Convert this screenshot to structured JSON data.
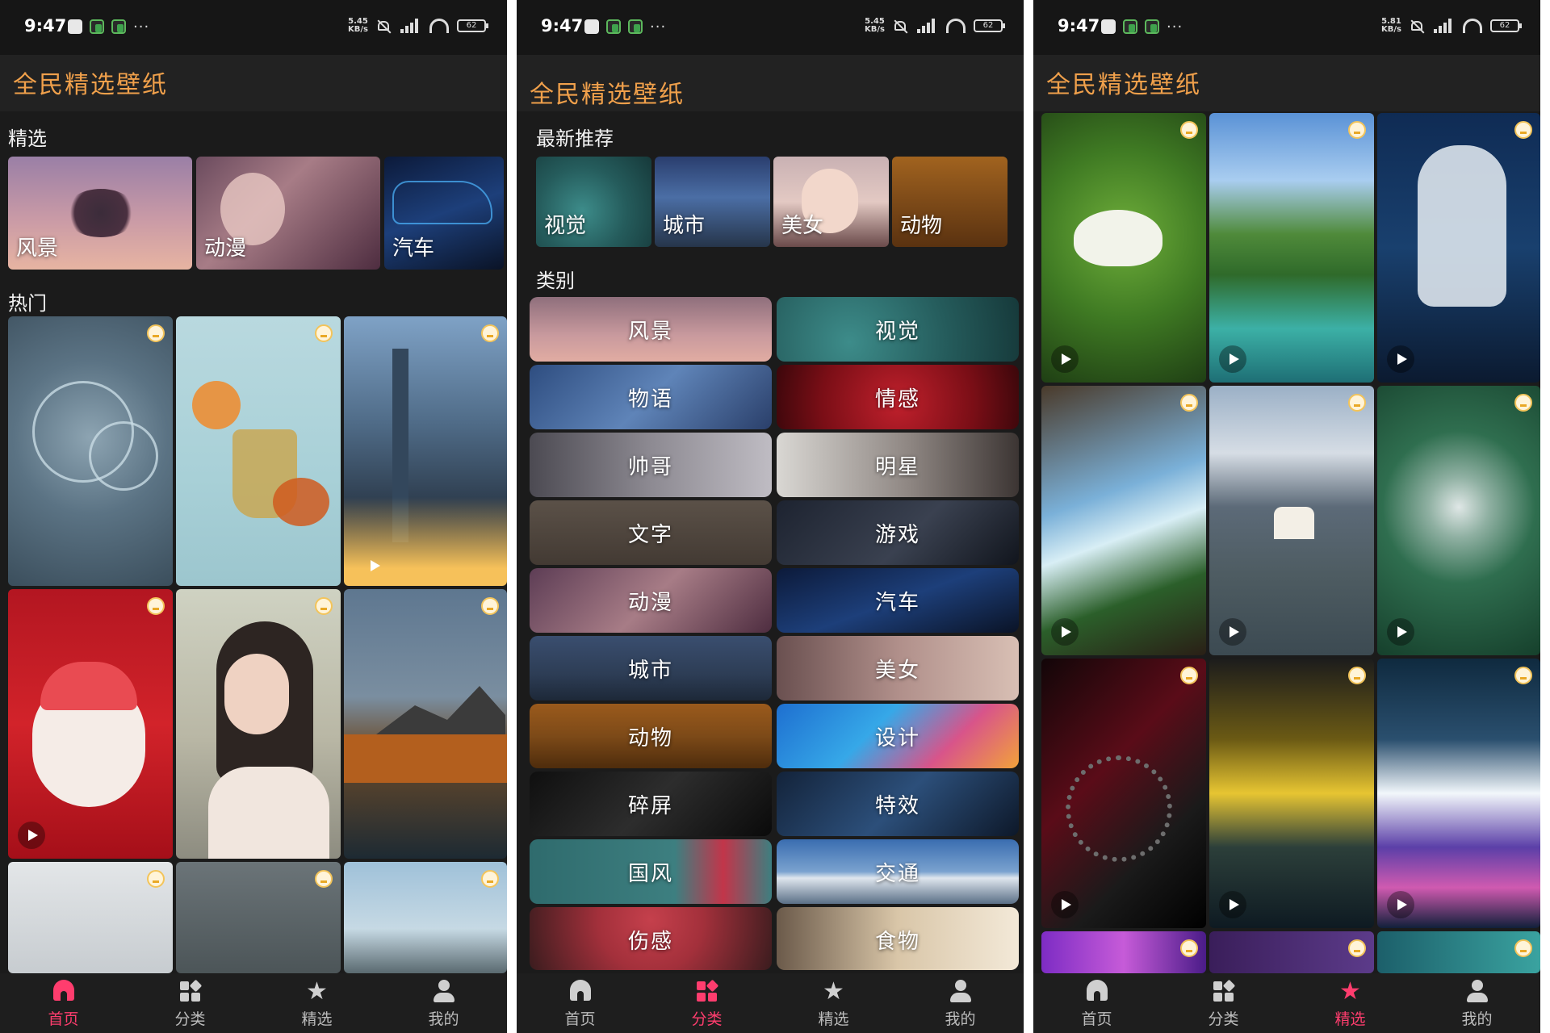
{
  "status_bars": [
    {
      "time": "9:47",
      "speed_value": "5.45",
      "speed_unit": "KB/s",
      "battery": "62"
    },
    {
      "time": "9:47",
      "speed_value": "5.45",
      "speed_unit": "KB/s",
      "battery": "62"
    },
    {
      "time": "9:47",
      "speed_value": "5.81",
      "speed_unit": "KB/s",
      "battery": "62"
    }
  ],
  "app": {
    "title": "全民精选壁纸",
    "accent": "#f0a04b",
    "nav_active_color": "#ff3d6e"
  },
  "home": {
    "featured_label": "精选",
    "featured": [
      {
        "label": "风景"
      },
      {
        "label": "动漫"
      },
      {
        "label": "汽车"
      }
    ],
    "hot_label": "热门"
  },
  "categories_page": {
    "latest_label": "最新推荐",
    "latest": [
      {
        "label": "视觉"
      },
      {
        "label": "城市"
      },
      {
        "label": "美女"
      },
      {
        "label": "动物"
      }
    ],
    "categories_label": "类别",
    "categories": [
      {
        "label": "风景"
      },
      {
        "label": "视觉"
      },
      {
        "label": "物语"
      },
      {
        "label": "情感"
      },
      {
        "label": "帅哥"
      },
      {
        "label": "明星"
      },
      {
        "label": "文字"
      },
      {
        "label": "游戏"
      },
      {
        "label": "动漫"
      },
      {
        "label": "汽车"
      },
      {
        "label": "城市"
      },
      {
        "label": "美女"
      },
      {
        "label": "动物"
      },
      {
        "label": "设计"
      },
      {
        "label": "碎屏"
      },
      {
        "label": "特效"
      },
      {
        "label": "国风"
      },
      {
        "label": "交通"
      },
      {
        "label": "伤感"
      },
      {
        "label": "食物"
      }
    ]
  },
  "nav": {
    "home": "首页",
    "categories": "分类",
    "picks": "精选",
    "mine": "我的"
  },
  "icons": [
    "home-icon",
    "grid-icon",
    "star-icon",
    "user-icon",
    "crown-icon",
    "play-icon",
    "wifi-icon",
    "signal-icon",
    "battery-icon",
    "mute-icon"
  ]
}
